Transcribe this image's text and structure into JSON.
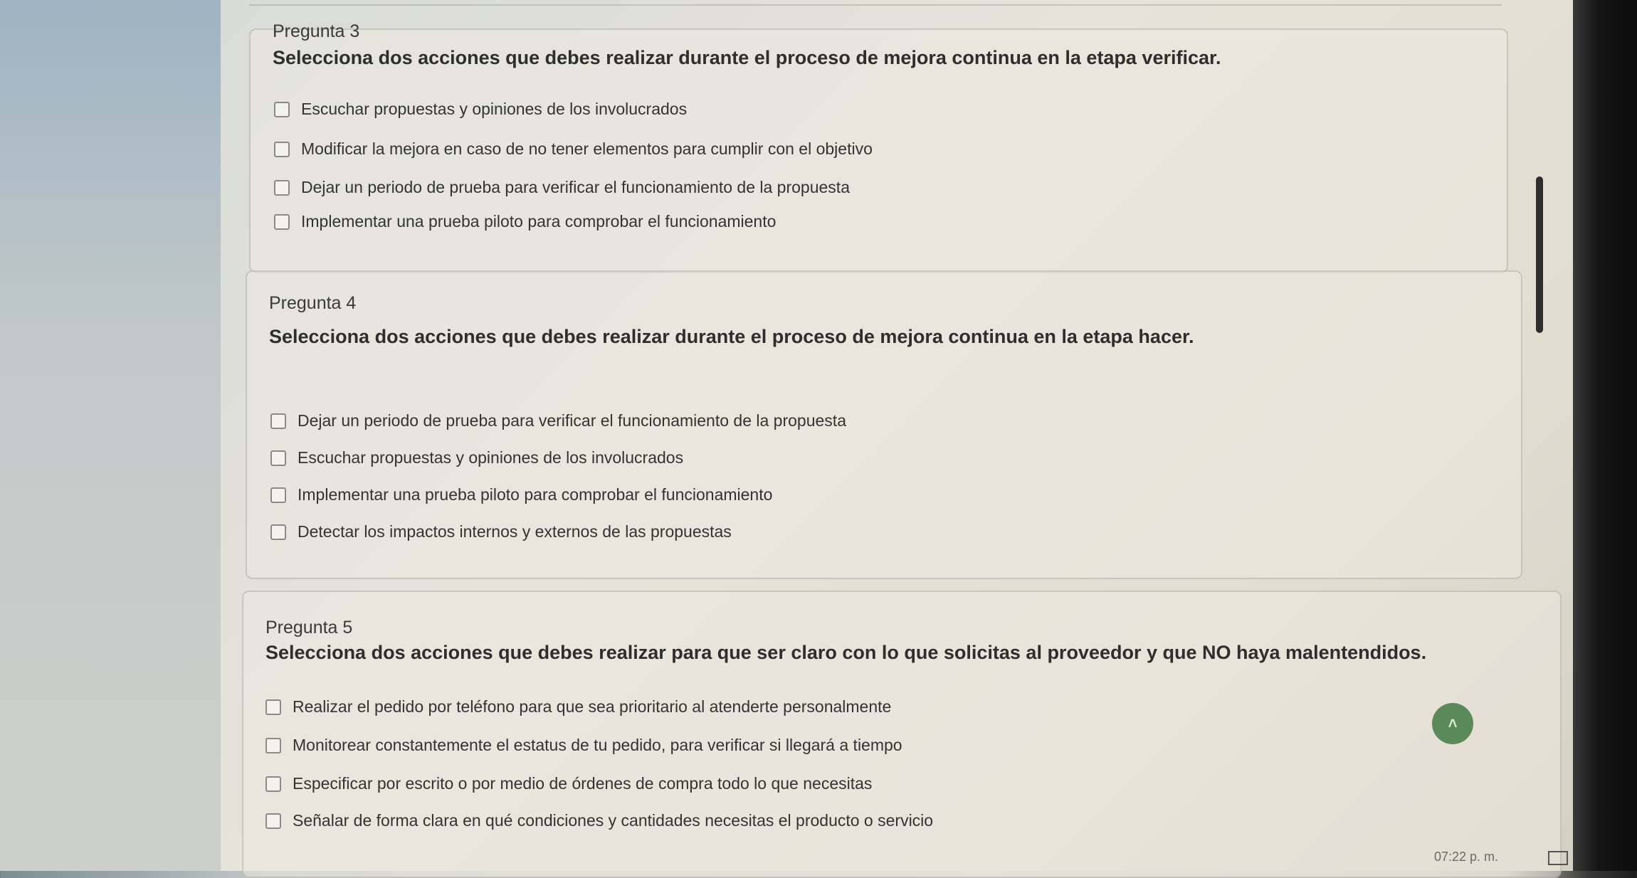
{
  "questions": [
    {
      "label": "Pregunta 3",
      "prompt": "Selecciona dos acciones que debes realizar durante el proceso de mejora continua en la etapa verificar.",
      "options": [
        "Escuchar propuestas y opiniones de los involucrados",
        "Modificar la mejora en caso de no tener elementos para cumplir con el objetivo",
        "Dejar un periodo de prueba para verificar el funcionamiento de la propuesta",
        "Implementar una prueba piloto para comprobar el funcionamiento"
      ]
    },
    {
      "label": "Pregunta 4",
      "prompt": "Selecciona dos acciones que debes realizar durante el proceso de mejora continua en la etapa hacer.",
      "options": [
        "Dejar un periodo de prueba para verificar el funcionamiento de la propuesta",
        "Escuchar propuestas y opiniones de los involucrados",
        "Implementar una prueba piloto para comprobar el funcionamiento",
        "Detectar los impactos internos y externos de las propuestas"
      ]
    },
    {
      "label": "Pregunta 5",
      "prompt": "Selecciona dos acciones que debes realizar para que ser claro con lo que solicitas al proveedor y que NO haya malentendidos.",
      "options": [
        "Realizar el pedido por teléfono para que sea prioritario al atenderte personalmente",
        "Monitorear constantemente el estatus de tu pedido, para verificar si llegará a tiempo",
        "Especificar por escrito o por medio de órdenes de compra todo lo que necesitas",
        "Señalar de forma clara en qué condiciones y cantidades necesitas el producto o servicio"
      ]
    }
  ],
  "taskbar": {
    "time": "07:22 p. m."
  },
  "fab_icon": "chevron-up-icon"
}
